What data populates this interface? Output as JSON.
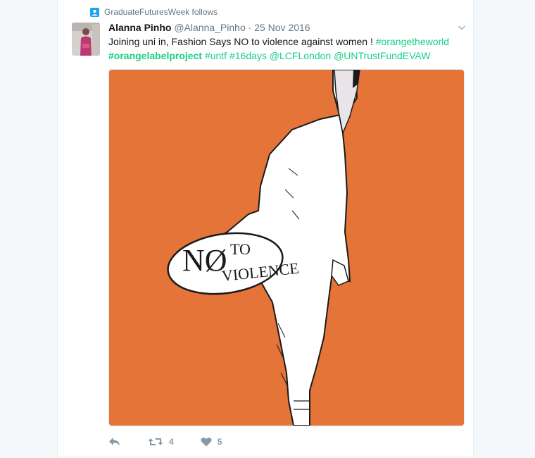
{
  "context": {
    "icon": "person-icon",
    "text": "GraduateFuturesWeek follows"
  },
  "tweet": {
    "author_name": "Alanna Pinho",
    "author_handle": "@Alanna_Pinho",
    "separator": "·",
    "date": "25 Nov 2016",
    "text_parts": {
      "line1_plain": "Joining uni in, Fashion Says NO to violence against women ! ",
      "hashtag1": "#orangetheworld",
      "hashtag2": "#orangelabelproject",
      "hashtag3": "#untf",
      "hashtag4": "#16days",
      "mention1": "@LCFLondon",
      "mention2": "@UNTrustFundEVAW"
    },
    "image": {
      "alt_text_visible": "NØ TO VIOLENCE",
      "word_no": "NØ",
      "word_to": "TO",
      "word_violence": "VIOLENCE",
      "background_color": "#e57438"
    }
  },
  "actions": {
    "reply_icon": "reply-icon",
    "retweet_icon": "retweet-icon",
    "retweet_count": "4",
    "like_icon": "heart-icon",
    "like_count": "5"
  },
  "colors": {
    "link": "#19cf86",
    "muted": "#657786",
    "action": "#8899a6",
    "context_icon": "#1da1f2"
  }
}
